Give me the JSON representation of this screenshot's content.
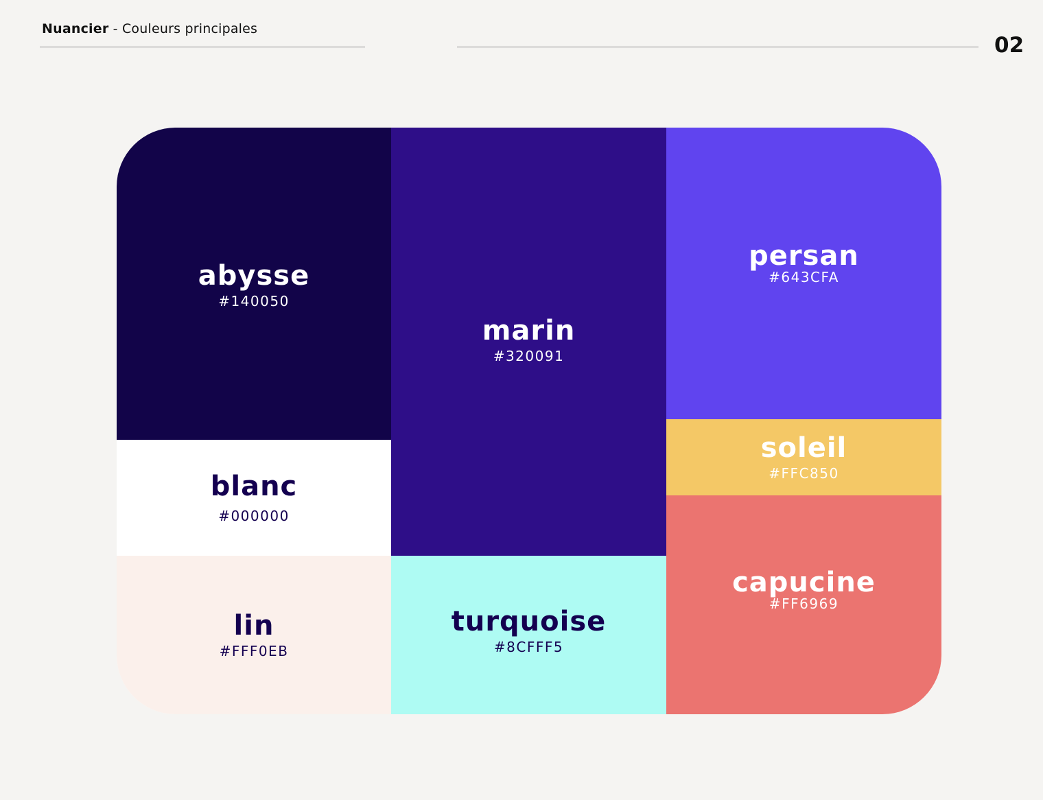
{
  "header": {
    "title_strong": "Nuancier",
    "title_separator": " - ",
    "title_rest": "Couleurs principales",
    "page_number": "02"
  },
  "swatches": {
    "abysse": {
      "name": "abysse",
      "hex": "#140050",
      "color": "#120449"
    },
    "blanc": {
      "name": "blanc",
      "hex": "#000000",
      "color": "#ffffff"
    },
    "lin": {
      "name": "lin",
      "hex": "#FFF0EB",
      "color": "#fbf0eb"
    },
    "marin": {
      "name": "marin",
      "hex": "#320091",
      "color": "#2e0e88"
    },
    "turquoise": {
      "name": "turquoise",
      "hex": "#8CFFF5",
      "color": "#aefbf3"
    },
    "persan": {
      "name": "persan",
      "hex": "#643CFA",
      "color": "#6044ef"
    },
    "soleil": {
      "name": "soleil",
      "hex": "#FFC850",
      "color": "#f4c866"
    },
    "capucine": {
      "name": "capucine",
      "hex": "#FF6969",
      "color": "#eb7470"
    }
  }
}
